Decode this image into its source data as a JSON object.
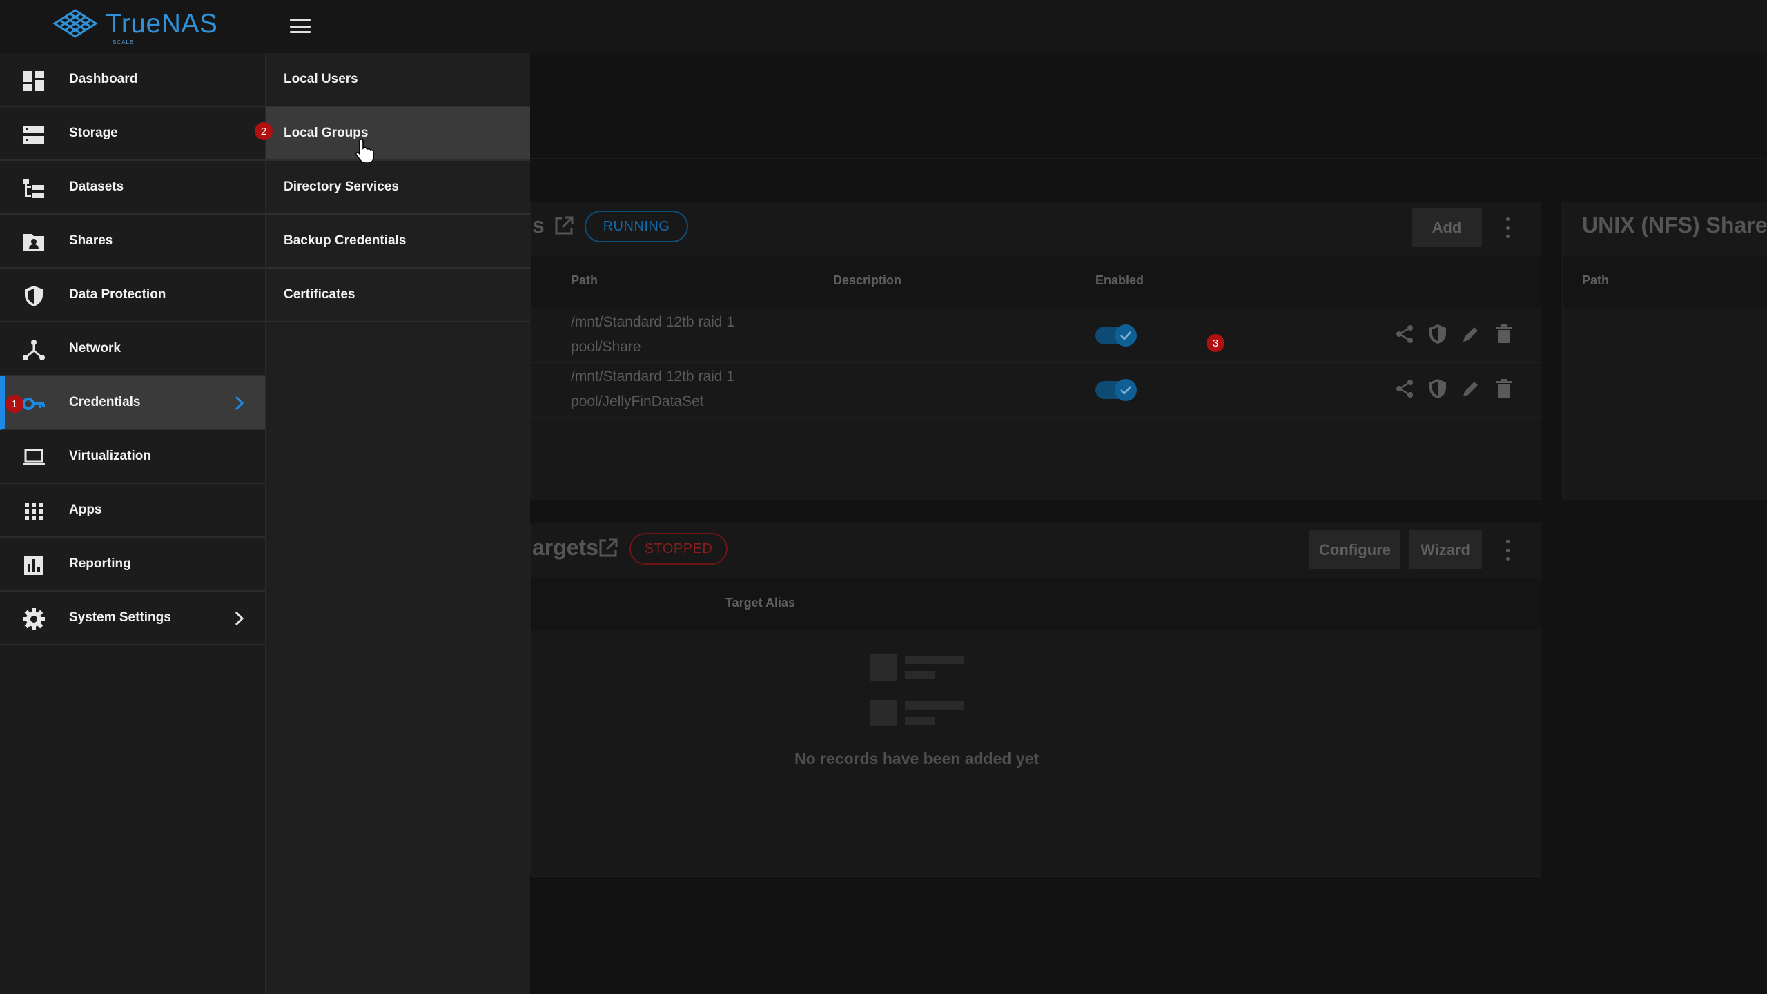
{
  "app": {
    "brand": "TrueNAS",
    "edition": "SCALE",
    "accent_color": "#1e88e5"
  },
  "sidebar": {
    "items": [
      {
        "label": "Dashboard",
        "icon": "dashboard-icon"
      },
      {
        "label": "Storage",
        "icon": "storage-icon"
      },
      {
        "label": "Datasets",
        "icon": "datasets-icon"
      },
      {
        "label": "Shares",
        "icon": "shares-icon"
      },
      {
        "label": "Data Protection",
        "icon": "shield-icon"
      },
      {
        "label": "Network",
        "icon": "network-icon"
      },
      {
        "label": "Credentials",
        "icon": "key-icon",
        "active": true
      },
      {
        "label": "Virtualization",
        "icon": "laptop-icon"
      },
      {
        "label": "Apps",
        "icon": "apps-grid-icon"
      },
      {
        "label": "Reporting",
        "icon": "bar-chart-icon"
      },
      {
        "label": "System Settings",
        "icon": "gear-icon"
      }
    ]
  },
  "submenu": {
    "items": [
      {
        "label": "Local Users"
      },
      {
        "label": "Local Groups",
        "hovered": true
      },
      {
        "label": "Directory Services"
      },
      {
        "label": "Backup Credentials"
      },
      {
        "label": "Certificates"
      }
    ]
  },
  "steps": {
    "one": "1",
    "two": "2",
    "three": "3"
  },
  "smb_card": {
    "title_partial": "s",
    "status": "RUNNING",
    "add_label": "Add",
    "columns": {
      "path": "Path",
      "description": "Description",
      "enabled": "Enabled"
    },
    "rows": [
      {
        "path_line1": "/mnt/Standard 12tb raid 1",
        "path_line2": "pool/Share",
        "enabled": true
      },
      {
        "path_line1": "/mnt/Standard 12tb raid 1",
        "path_line2": "pool/JellyFinDataSet",
        "enabled": true
      }
    ]
  },
  "nfs_card": {
    "title": "UNIX (NFS) Shares",
    "column_path": "Path"
  },
  "iscsi_card": {
    "title_partial": "argets",
    "status": "STOPPED",
    "configure_label": "Configure",
    "wizard_label": "Wizard",
    "column_target_alias": "Target Alias",
    "empty_text": "No records have been added yet"
  }
}
